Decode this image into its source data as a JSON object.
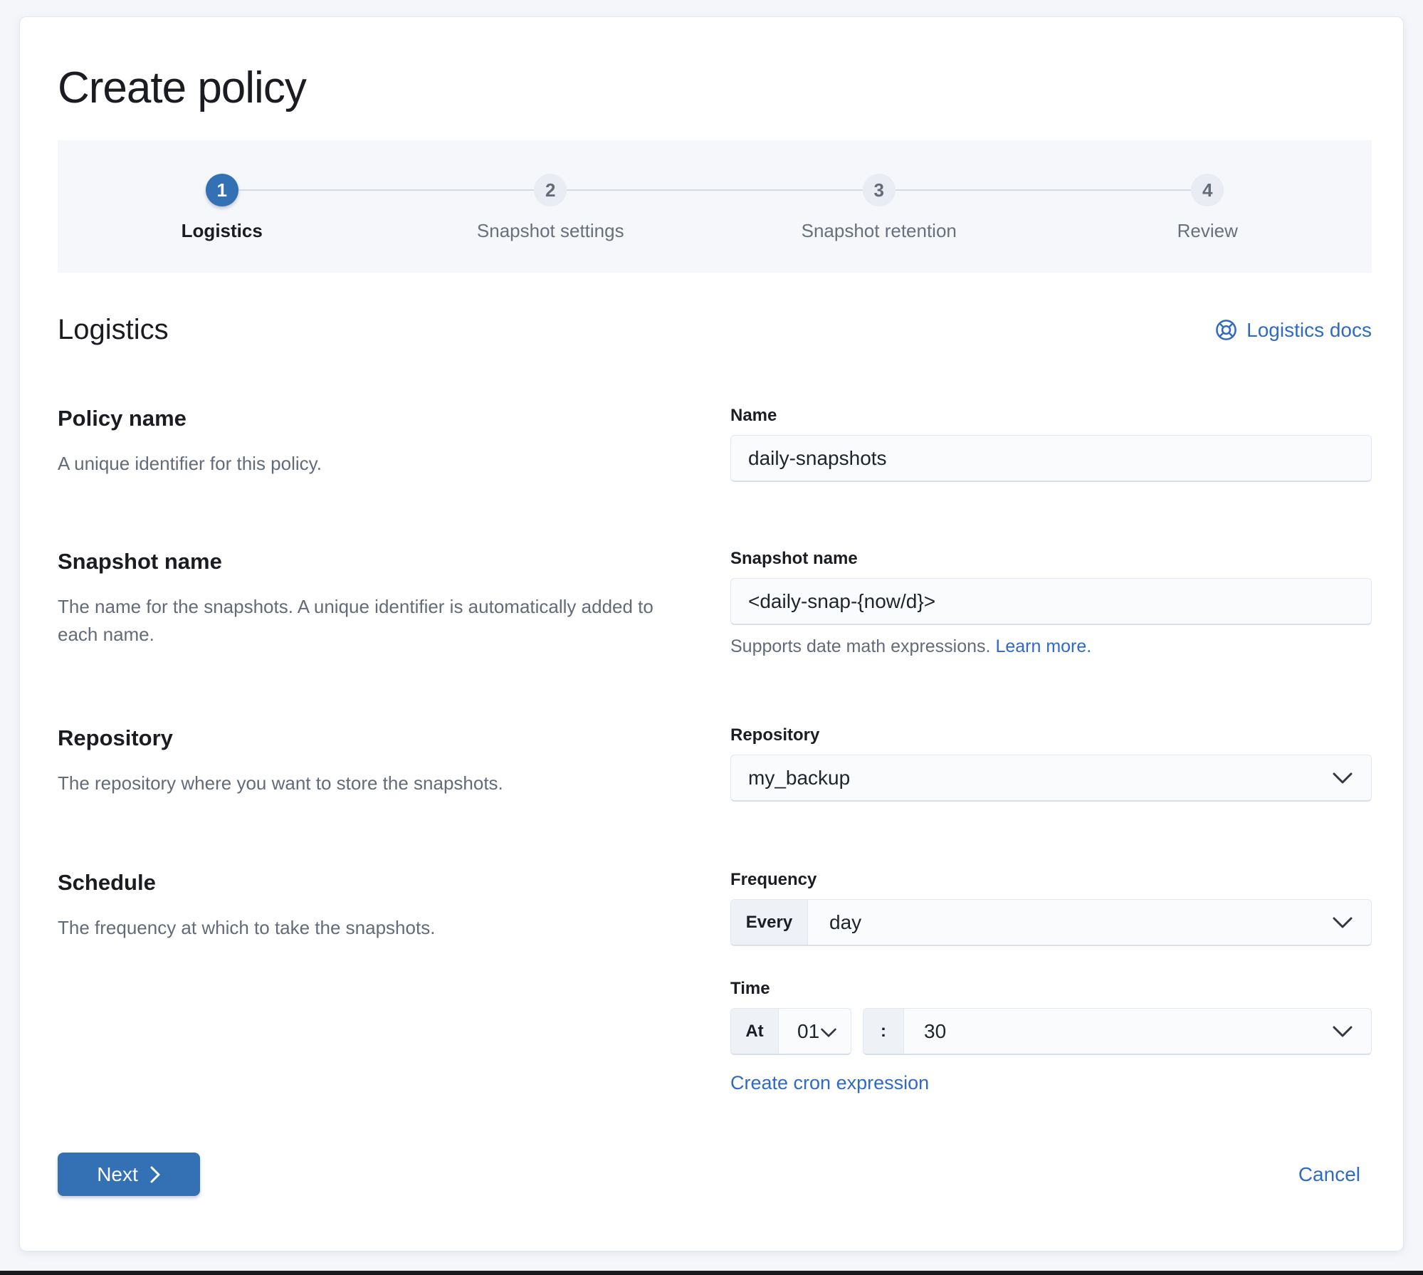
{
  "page": {
    "title": "Create policy"
  },
  "stepper": {
    "steps": [
      {
        "number": "1",
        "label": "Logistics",
        "status": "active"
      },
      {
        "number": "2",
        "label": "Snapshot settings",
        "status": "incomplete"
      },
      {
        "number": "3",
        "label": "Snapshot retention",
        "status": "incomplete"
      },
      {
        "number": "4",
        "label": "Review",
        "status": "incomplete"
      }
    ]
  },
  "section": {
    "title": "Logistics",
    "docs_link_label": "Logistics docs",
    "docs_icon": "help-life-ring-icon"
  },
  "groups": {
    "policy_name": {
      "title": "Policy name",
      "description": "A unique identifier for this policy.",
      "field_label": "Name",
      "value": "daily-snapshots"
    },
    "snapshot_name": {
      "title": "Snapshot name",
      "description": "The name for the snapshots. A unique identifier is automatically added to each name.",
      "field_label": "Snapshot name",
      "value": "<daily-snap-{now/d}>",
      "help_text": "Supports date math expressions.",
      "help_link_label": "Learn more."
    },
    "repository": {
      "title": "Repository",
      "description": "The repository where you want to store the snapshots.",
      "field_label": "Repository",
      "value": "my_backup"
    },
    "schedule": {
      "title": "Schedule",
      "description": "The frequency at which to take the snapshots.",
      "frequency_label": "Frequency",
      "frequency_prepend": "Every",
      "frequency_value": "day",
      "time_label": "Time",
      "time_prepend": "At",
      "hour_value": "01",
      "separator": ":",
      "minute_value": "30",
      "cron_link_label": "Create cron expression"
    }
  },
  "footer": {
    "next_label": "Next",
    "cancel_label": "Cancel"
  },
  "colors": {
    "primary_blue": "#3370b4",
    "link_blue": "#2f6ac4",
    "text_dark": "#1a1c21",
    "text_gray": "#646b78",
    "band_gray": "#f5f7fa",
    "control_bg": "#fafbfd"
  }
}
